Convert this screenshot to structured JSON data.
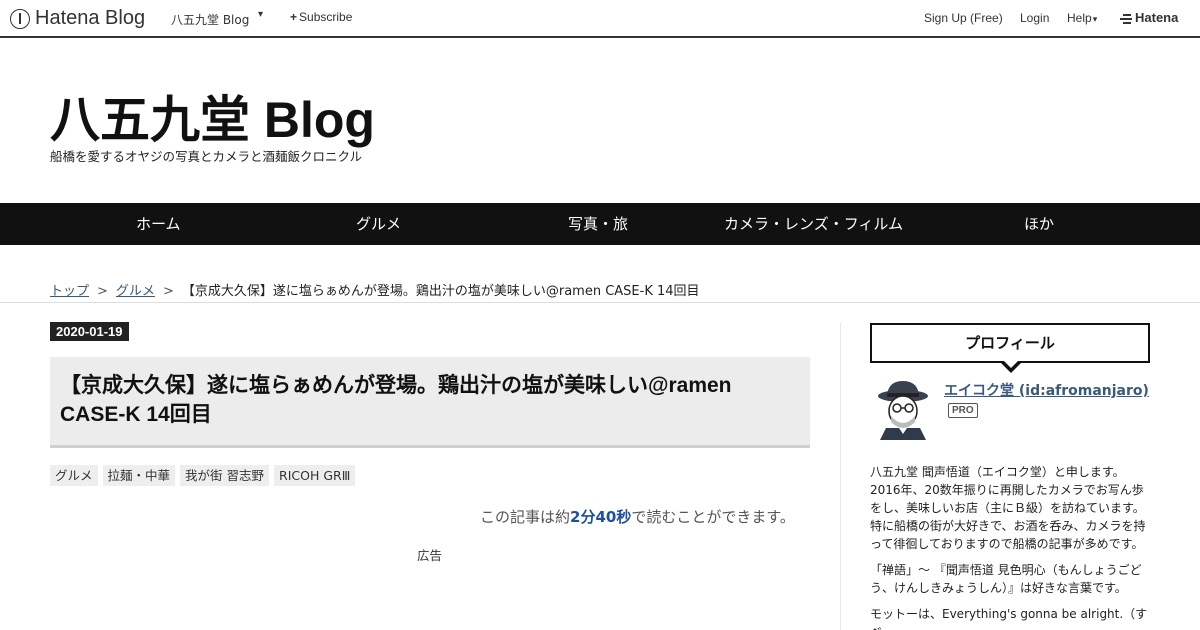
{
  "topbar": {
    "logo": "Hatena Blog",
    "blog_name": "八五九堂 Blog",
    "caret": "▾",
    "subscribe_plus": "+",
    "subscribe": "Subscribe",
    "signup": "Sign Up (Free)",
    "login": "Login",
    "help": "Help",
    "help_caret": "▾",
    "hatena": "Hatena"
  },
  "header": {
    "title": "八五九堂 Blog",
    "description": "船橋を愛するオヤジの写真とカメラと酒麺飯クロニクル"
  },
  "nav": {
    "items": [
      "ホーム",
      "グルメ",
      "写真・旅",
      "カメラ・レンズ・フィルム",
      "ほか"
    ]
  },
  "breadcrumb": {
    "top": "トップ",
    "sep": ">",
    "category": "グルメ",
    "current": "【京成大久保】遂に塩らぁめんが登場。鶏出汁の塩が美味しい@ramen CASE-K 14回目"
  },
  "article": {
    "date": "2020-01-19",
    "title": "【京成大久保】遂に塩らぁめんが登場。鶏出汁の塩が美味しい@ramen CASE-K 14回目",
    "categories": [
      "グルメ",
      "拉麺・中華",
      "我が街 習志野",
      "RICOH GRⅢ"
    ],
    "read_prefix": "この記事は約",
    "read_time": "2分40秒",
    "read_suffix": "で読むことができます。",
    "ad_label": "広告"
  },
  "sidebar": {
    "profile_heading": "プロフィール",
    "name": "エイコク堂 (id:afromanjaro)",
    "badge": "PRO",
    "bio_1": "八五九堂 聞声悟道（エイコク堂）と申します。2016年、20数年振りに再開したカメラでお写ん歩をし、美味しいお店（主にＢ級）を訪ねています。特に船橋の街が大好きで、お酒を呑み、カメラを持って徘徊しておりますので船橋の記事が多めです。",
    "bio_2": "「禅語」～ 『聞声悟道 見色明心（もんしょうごどう、けんしきみょうしん）』は好きな言葉です。",
    "bio_3": "モットーは、Everything's gonna be alright.（すべ"
  }
}
